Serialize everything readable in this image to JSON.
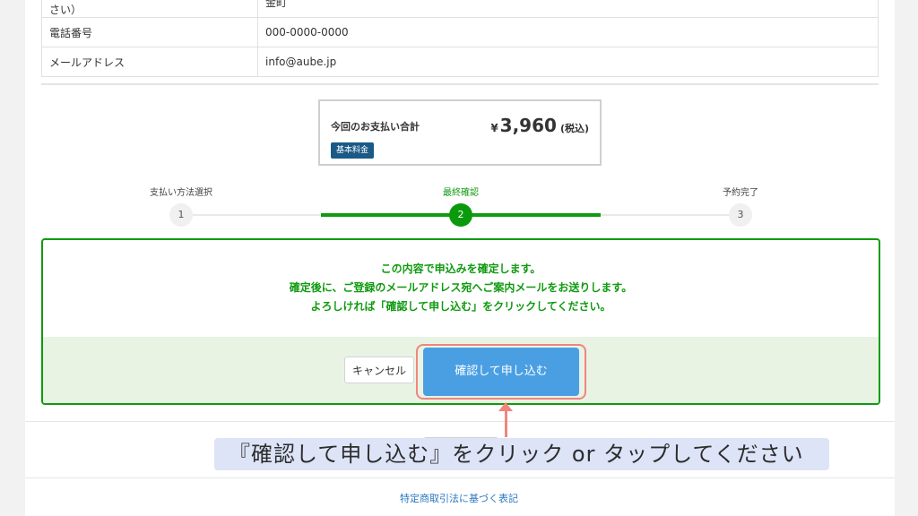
{
  "info_table": {
    "rows": [
      {
        "label": "町名以降の住所（ここから入力してください）",
        "value": "金町"
      },
      {
        "label": "電話番号",
        "value": "000-0000-0000"
      },
      {
        "label": "メールアドレス",
        "value": "info@aube.jp"
      }
    ]
  },
  "total": {
    "label": "今回のお支払い合計",
    "currency": "¥",
    "amount": "3,960",
    "tax_note": "(税込)",
    "badge": "基本料金"
  },
  "stepper": {
    "steps": [
      {
        "number": "1",
        "label": "支払い方法選択"
      },
      {
        "number": "2",
        "label": "最終確認"
      },
      {
        "number": "3",
        "label": "予約完了"
      }
    ],
    "current_step": 2
  },
  "confirm": {
    "lines": [
      "この内容で申込みを確定します。",
      "確定後に、ご登録のメールアドレス宛へご案内メールをお送りします。",
      "よろしければ「確認して申し込む」をクリックしてください。"
    ],
    "cancel_label": "キャンセル",
    "submit_label": "確認して申し込む"
  },
  "footer": {
    "link_label": "特定商取引法に基づく表記"
  },
  "annotation": {
    "text": "『確認して申し込む』をクリック or タップしてください"
  },
  "colors": {
    "accent_green": "#109a10",
    "submit_blue": "#4a9fe3",
    "highlight_red": "#f0857e",
    "badge_navy": "#1b5a86"
  }
}
